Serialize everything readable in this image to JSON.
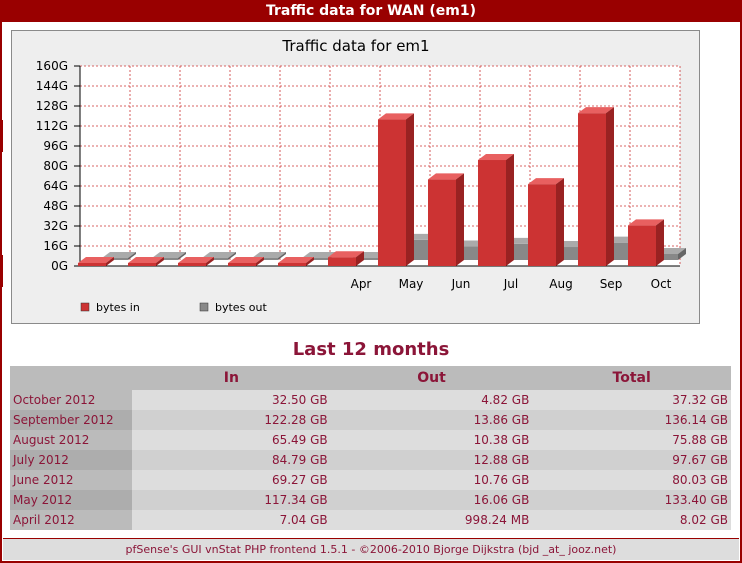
{
  "page": {
    "header_title": "Traffic data for WAN (em1)",
    "section_title": "Last 12 months",
    "footer_text": "pfSense's GUI vnStat PHP frontend 1.5.1 - ©2006-2010 Bjorge Dijkstra (bjd _at_ jooz.net)"
  },
  "colors": {
    "brand": "#990000",
    "text_accent": "#8b1538",
    "bytes_in": "#cc3333",
    "bytes_out": "#888888"
  },
  "table": {
    "headers": [
      "",
      "In",
      "Out",
      "Total"
    ],
    "rows": [
      {
        "label": "October 2012",
        "in": "32.50 GB",
        "out": "4.82 GB",
        "total": "37.32 GB"
      },
      {
        "label": "September 2012",
        "in": "122.28 GB",
        "out": "13.86 GB",
        "total": "136.14 GB"
      },
      {
        "label": "August 2012",
        "in": "65.49 GB",
        "out": "10.38 GB",
        "total": "75.88 GB"
      },
      {
        "label": "July 2012",
        "in": "84.79 GB",
        "out": "12.88 GB",
        "total": "97.67 GB"
      },
      {
        "label": "June 2012",
        "in": "69.27 GB",
        "out": "10.76 GB",
        "total": "80.03 GB"
      },
      {
        "label": "May 2012",
        "in": "117.34 GB",
        "out": "16.06 GB",
        "total": "133.40 GB"
      },
      {
        "label": "April 2012",
        "in": "7.04 GB",
        "out": "998.24 MB",
        "total": "8.02 GB"
      }
    ]
  },
  "chart_data": {
    "type": "bar",
    "title": "Traffic data for em1",
    "xlabel": "",
    "ylabel": "",
    "categories": [
      "",
      "",
      "",
      "",
      "",
      "Apr",
      "May",
      "Jun",
      "Jul",
      "Aug",
      "Sep",
      "Oct"
    ],
    "series": [
      {
        "name": "bytes in",
        "values": [
          0,
          0,
          0,
          0,
          0,
          7.04,
          117.34,
          69.27,
          84.79,
          65.49,
          122.28,
          32.5
        ]
      },
      {
        "name": "bytes out",
        "values": [
          0,
          0,
          0,
          0,
          0,
          0.98,
          16.06,
          10.76,
          12.88,
          10.38,
          13.86,
          4.82
        ]
      }
    ],
    "yticks": [
      "0G",
      "16G",
      "32G",
      "48G",
      "64G",
      "80G",
      "96G",
      "112G",
      "128G",
      "144G",
      "160G"
    ],
    "ylim": [
      0,
      160
    ],
    "grid": true,
    "legend_position": "bottom-left"
  }
}
